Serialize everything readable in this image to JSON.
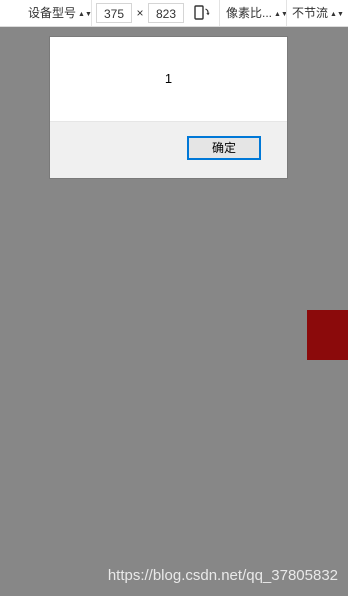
{
  "toolbar": {
    "device_label": "设备型号",
    "width_value": "375",
    "times_symbol": "×",
    "height_value": "823",
    "pixel_ratio_label": "像素比...",
    "throttle_label": "不节流"
  },
  "dialog": {
    "message": "1",
    "ok_label": "确定"
  },
  "watermark": "https://blog.csdn.net/qq_37805832",
  "colors": {
    "page_background": "#878787",
    "red_block": "#8b0a0b",
    "button_border": "#0078d7"
  },
  "icons": {
    "rotate": "rotate-device-icon",
    "caret": "sort-caret-icon"
  }
}
